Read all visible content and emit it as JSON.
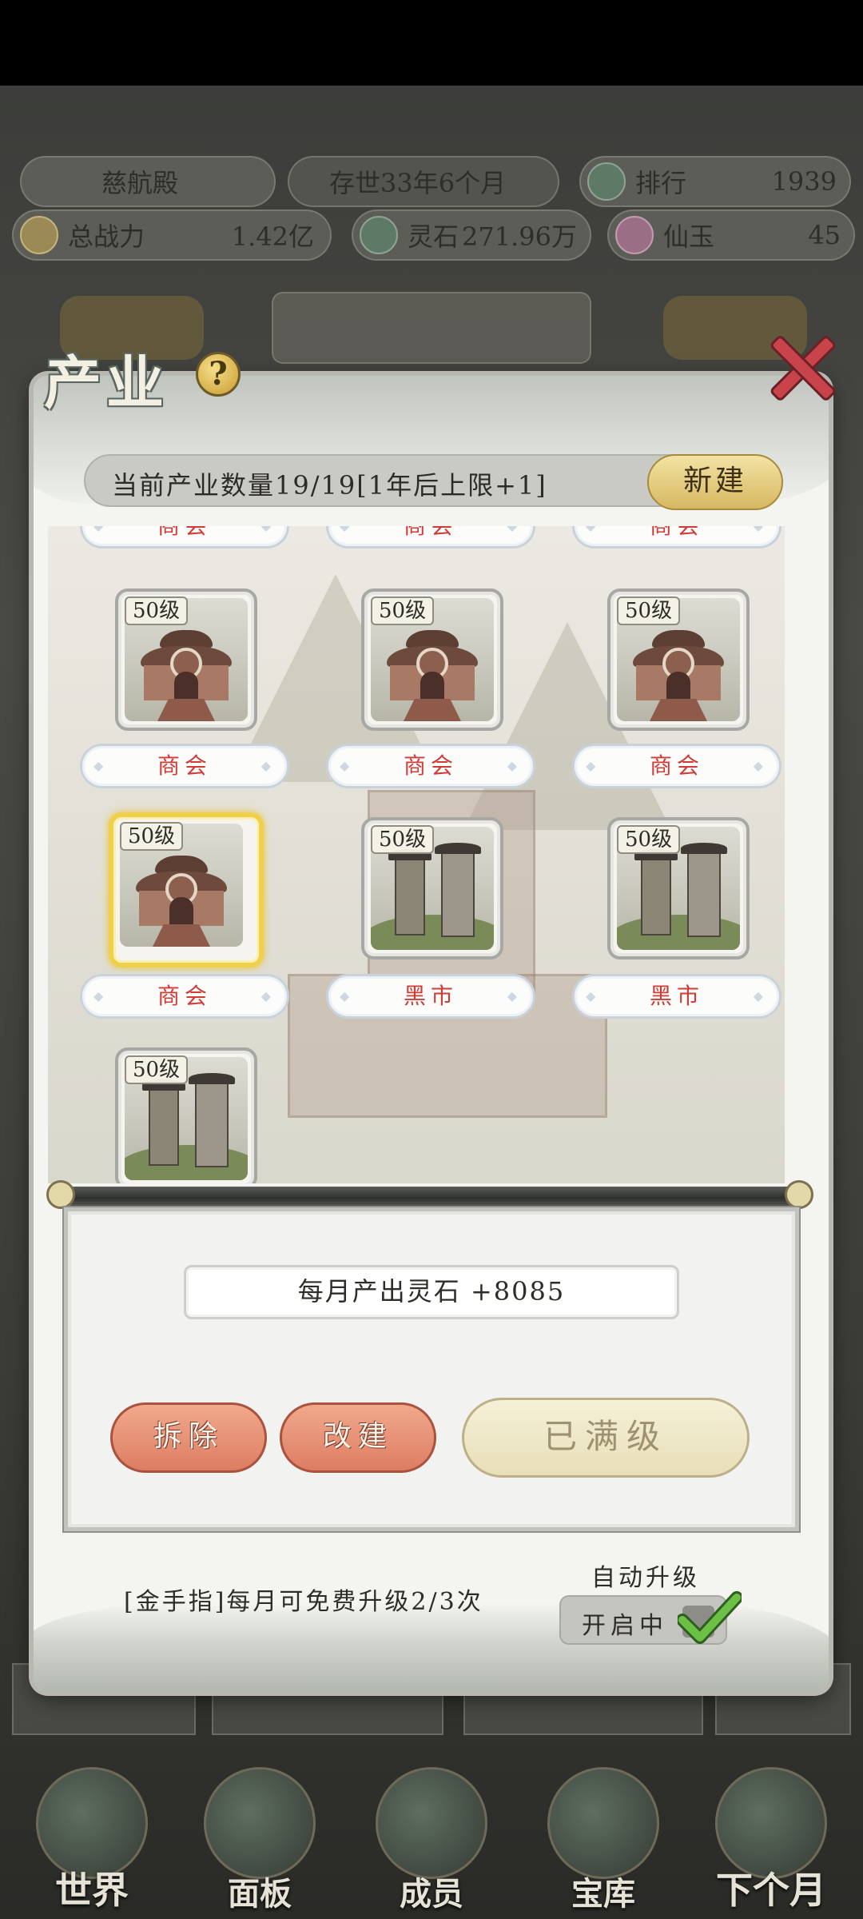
{
  "hud": {
    "location": "慈航殿",
    "age": "存世33年6个月",
    "rank_label": "排行",
    "rank_value": "1939",
    "power_label": "总战力",
    "power_value": "1.42亿",
    "spirit_stone_label": "灵石",
    "spirit_stone_value": "271.96万",
    "jade_label": "仙玉",
    "jade_value": "45"
  },
  "modal": {
    "title": "产业",
    "help_icon": "question-icon",
    "close_icon": "close-icon",
    "info_text": "当前产业数量19/19[1年后上限+1]",
    "new_button": "新建"
  },
  "grid": {
    "partial_row_labels": [
      "商会",
      "商会",
      "商会"
    ],
    "rows": [
      {
        "cards": [
          {
            "level": "50级",
            "type": "hall",
            "label": "商会"
          },
          {
            "level": "50级",
            "type": "hall",
            "label": "商会"
          },
          {
            "level": "50级",
            "type": "hall",
            "label": "商会"
          }
        ]
      },
      {
        "cards": [
          {
            "level": "50级",
            "type": "hall",
            "label": "商会",
            "selected": true
          },
          {
            "level": "50级",
            "type": "market",
            "label": "黑市"
          },
          {
            "level": "50级",
            "type": "market",
            "label": "黑市"
          }
        ]
      },
      {
        "cards": [
          {
            "level": "50级",
            "type": "market"
          }
        ]
      }
    ]
  },
  "detail": {
    "output": "每月产出灵石 +8085",
    "demolish_button": "拆除",
    "rebuild_button": "改建",
    "max_level_button": "已满级"
  },
  "footer": {
    "tip": "[金手指]每月可免费升级2/3次",
    "auto_upgrade_label": "自动升级",
    "auto_upgrade_state": "开启中",
    "check_color": "#5cae3c"
  },
  "bottom_nav": {
    "items": [
      "世界",
      "面板",
      "成员",
      "宝库",
      "下个月"
    ]
  }
}
